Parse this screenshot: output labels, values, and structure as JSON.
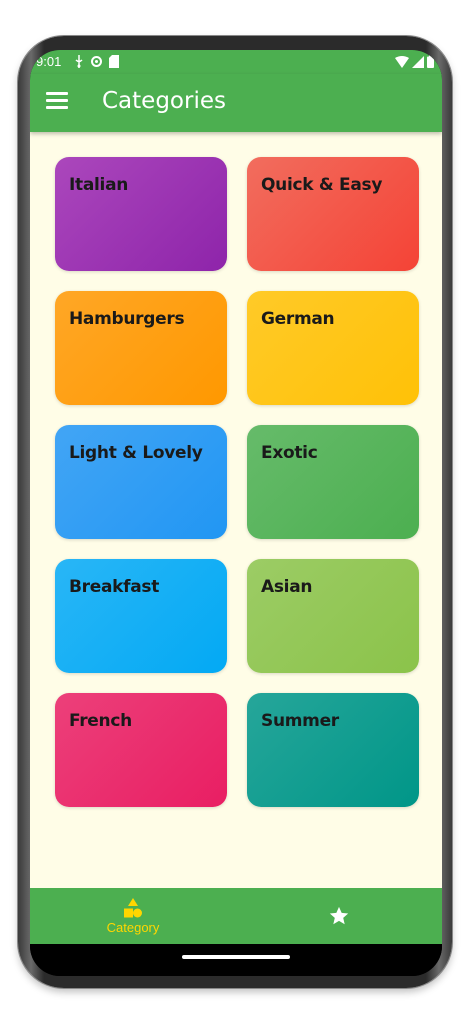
{
  "status_bar": {
    "time": "9:01"
  },
  "app_bar": {
    "title": "Categories"
  },
  "categories": [
    {
      "label": "Italian",
      "color_from": "#ab47bc",
      "color_to": "#8e24aa"
    },
    {
      "label": "Quick & Easy",
      "color_from": "#f26d5e",
      "color_to": "#f44336"
    },
    {
      "label": "Hamburgers",
      "color_from": "#ffa726",
      "color_to": "#ff9800"
    },
    {
      "label": "German",
      "color_from": "#ffca28",
      "color_to": "#ffc107"
    },
    {
      "label": "Light & Lovely",
      "color_from": "#42a5f5",
      "color_to": "#2196f3"
    },
    {
      "label": "Exotic",
      "color_from": "#66bb6a",
      "color_to": "#4caf50"
    },
    {
      "label": "Breakfast",
      "color_from": "#29b6f6",
      "color_to": "#03a9f4"
    },
    {
      "label": "Asian",
      "color_from": "#9ccc65",
      "color_to": "#8bc34a"
    },
    {
      "label": "French",
      "color_from": "#ec407a",
      "color_to": "#e91e63"
    },
    {
      "label": "Summer",
      "color_from": "#26a69a",
      "color_to": "#009688"
    }
  ],
  "bottom_nav": {
    "items": [
      {
        "label": "Category",
        "icon": "category-icon",
        "selected": true
      },
      {
        "label": "",
        "icon": "star-icon",
        "selected": false
      }
    ]
  },
  "colors": {
    "primary": "#4caf50",
    "background": "#fffde7",
    "accent": "#ffd600"
  }
}
